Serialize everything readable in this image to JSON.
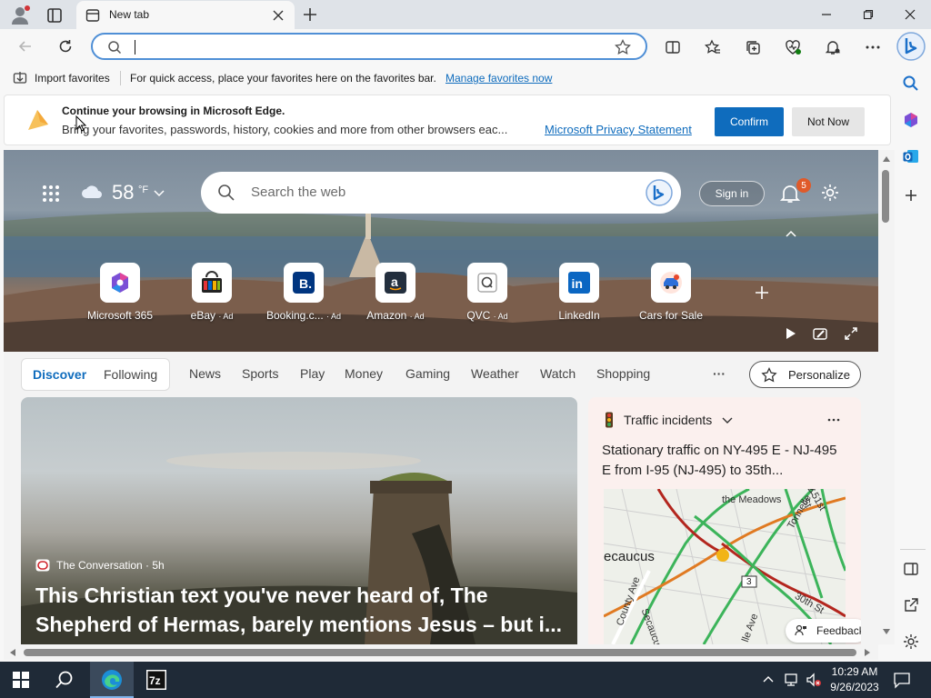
{
  "browser": {
    "tab_title": "New tab",
    "address_value": "",
    "favbar_import": "Import favorites",
    "favbar_text": "For quick access, place your favorites here on the favorites bar.",
    "favbar_link": "Manage favorites now"
  },
  "banner": {
    "title": "Continue your browsing in Microsoft Edge.",
    "body": "Bring your favorites, passwords, history, cookies and more from other browsers eac...",
    "link": "Microsoft Privacy Statement",
    "confirm": "Confirm",
    "not_now": "Not Now"
  },
  "newtab": {
    "weather_temp": "58",
    "weather_unit": "°F",
    "search_placeholder": "Search the web",
    "sign_in": "Sign in",
    "notification_count": "5",
    "shortcuts": [
      {
        "label": "Microsoft 365",
        "ad": "",
        "icon": "m365-icon"
      },
      {
        "label": "eBay",
        "ad": "· Ad",
        "icon": "ebay-icon"
      },
      {
        "label": "Booking.c...",
        "ad": "· Ad",
        "icon": "booking-icon"
      },
      {
        "label": "Amazon",
        "ad": "· Ad",
        "icon": "amazon-icon"
      },
      {
        "label": "QVC",
        "ad": "· Ad",
        "icon": "qvc-icon"
      },
      {
        "label": "LinkedIn",
        "ad": "",
        "icon": "linkedin-icon"
      },
      {
        "label": "Cars for Sale",
        "ad": "",
        "icon": "cars-icon"
      }
    ],
    "nav": {
      "discover": "Discover",
      "following": "Following",
      "items": [
        "News",
        "Sports",
        "Play",
        "Money",
        "Gaming",
        "Weather",
        "Watch",
        "Shopping"
      ],
      "more": "···",
      "personalize": "Personalize"
    },
    "main_card": {
      "source": "The Conversation · 5h",
      "headline": "This Christian text you've never heard of, The Shepherd of Hermas, barely mentions Jesus – but i..."
    },
    "traffic_card": {
      "title": "Traffic incidents",
      "headline": "Stationary traffic on NY-495 E - NJ-495 E from I-95 (NJ-495) to 35th...",
      "map_labels": [
        "the Meadows",
        "ecaucus",
        "Secaucus Rd",
        "County Ave",
        "Tonnelle Ave",
        "30th St",
        "51st St",
        "lle Ave",
        "3"
      ],
      "feedback": "Feedback"
    }
  },
  "taskbar": {
    "time": "10:29 AM",
    "date": "9/26/2023"
  },
  "colors": {
    "accent": "#0f6cbd",
    "link": "#0f6cbd",
    "titlebar": "#dfe3e8",
    "taskbar": "#1f2a37"
  }
}
